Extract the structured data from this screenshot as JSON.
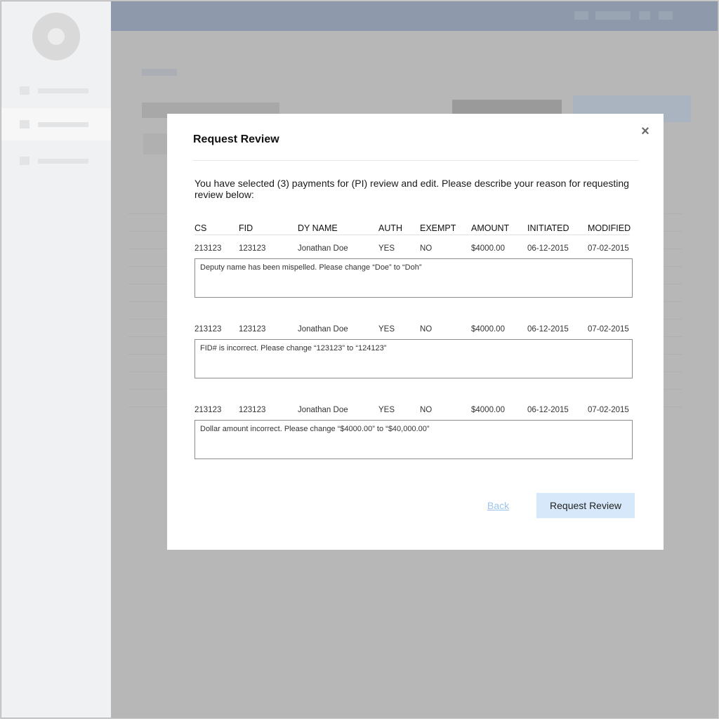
{
  "modal": {
    "title": "Request Review",
    "close_icon": "×",
    "intro": "You have selected (3) payments for (PI) review and edit. Please describe your reason for requesting review below:",
    "columns": [
      "CS",
      "FID",
      "DY NAME",
      "AUTH",
      "EXEMPT",
      "AMOUNT",
      "INITIATED",
      "MODIFIED"
    ],
    "rows": [
      {
        "cs": "213123",
        "fid": "123123",
        "dy_name": "Jonathan Doe",
        "auth": "YES",
        "exempt": "NO",
        "amount": "$4000.00",
        "initiated": "06-12-2015",
        "modified": "07-02-2015",
        "reason": "Deputy name has been mispelled. Please change “Doe” to “Doh”"
      },
      {
        "cs": "213123",
        "fid": "123123",
        "dy_name": "Jonathan Doe",
        "auth": "YES",
        "exempt": "NO",
        "amount": "$4000.00",
        "initiated": "06-12-2015",
        "modified": "07-02-2015",
        "reason": "FID# is incorrect. Please change “123123” to “124123”"
      },
      {
        "cs": "213123",
        "fid": "123123",
        "dy_name": "Jonathan Doe",
        "auth": "YES",
        "exempt": "NO",
        "amount": "$4000.00",
        "initiated": "06-12-2015",
        "modified": "07-02-2015",
        "reason": "Dollar amount incorrect. Please change “$4000.00” to “$40,000.00”"
      }
    ],
    "back_label": "Back",
    "submit_label": "Request Review"
  },
  "colors": {
    "overlay": "#b7b7b7",
    "topbar": "#8e9aab",
    "sidebar": "#f0f1f3",
    "link": "#9cc3ec",
    "primary_button": "#d7e8fb"
  },
  "icons": {
    "close": "close-icon",
    "avatar": "avatar-placeholder"
  }
}
